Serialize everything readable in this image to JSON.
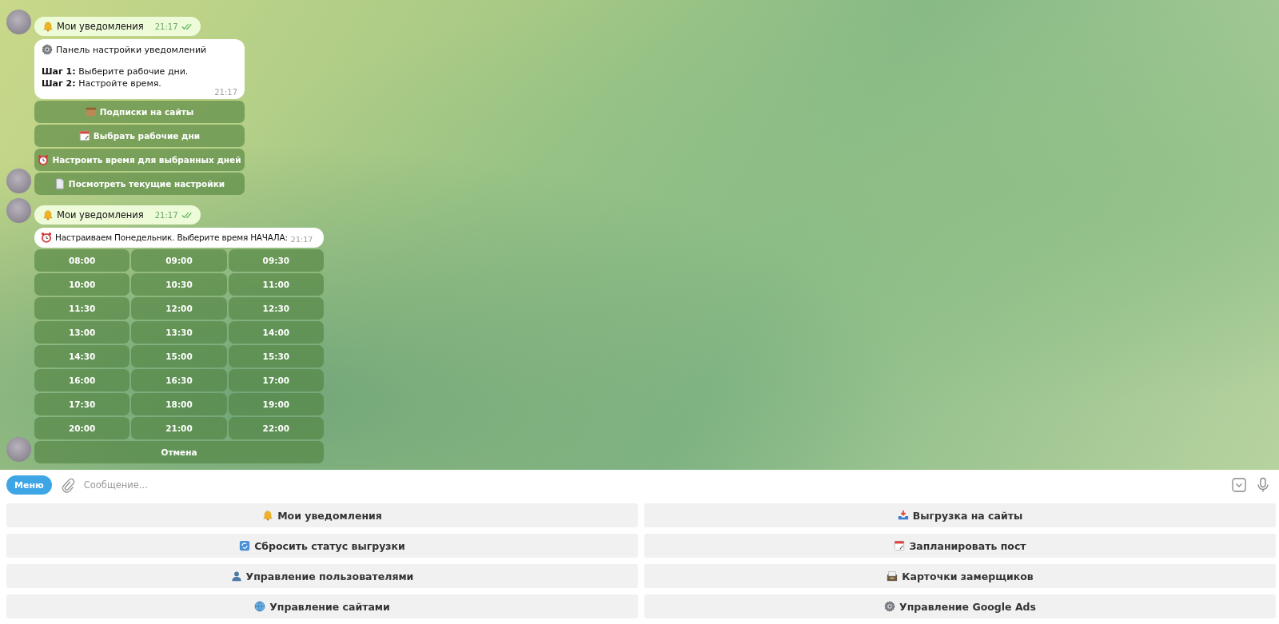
{
  "chat": {
    "messages": [
      {
        "kind": "outgoing",
        "text": "Мои уведомления",
        "time": "21:17",
        "read": true
      },
      {
        "kind": "bot",
        "paragraphs": [
          "Панель настройки уведомлений",
          "**Шаг 1:** Выберите рабочие дни.\n**Шаг 2:** Настройте время."
        ],
        "time": "21:17",
        "buttons": [
          [
            "Подписки на сайты"
          ],
          [
            "Выбрать рабочие дни"
          ],
          [
            "Настроить время для выбранных дней"
          ],
          [
            "Посмотреть текущие настройки"
          ]
        ]
      },
      {
        "kind": "outgoing",
        "text": "Мои уведомления",
        "time": "21:17",
        "read": true
      },
      {
        "kind": "bot",
        "paragraphs": [
          "Настраиваем Понедельник. Выберите время НАЧАЛА:"
        ],
        "time": "21:17",
        "buttons": [
          [
            "08:00",
            "09:00",
            "09:30"
          ],
          [
            "10:00",
            "10:30",
            "11:00"
          ],
          [
            "11:30",
            "12:00",
            "12:30"
          ],
          [
            "13:00",
            "13:30",
            "14:00"
          ],
          [
            "14:30",
            "15:00",
            "15:30"
          ],
          [
            "16:00",
            "16:30",
            "17:00"
          ],
          [
            "17:30",
            "18:00",
            "19:00"
          ],
          [
            "20:00",
            "21:00",
            "22:00"
          ],
          [
            "Отмена"
          ]
        ]
      }
    ]
  },
  "composer": {
    "menu_button": "Меню",
    "placeholder": "Сообщение..."
  },
  "keyboard": {
    "buttons": [
      [
        "Мои уведомления",
        "Выгрузка на сайты"
      ],
      [
        "Сбросить статус выгрузки",
        "Запланировать пост"
      ],
      [
        "Управление пользователями",
        "Карточки замерщиков"
      ],
      [
        "Управление сайтами",
        "Управление Google Ads"
      ]
    ]
  }
}
